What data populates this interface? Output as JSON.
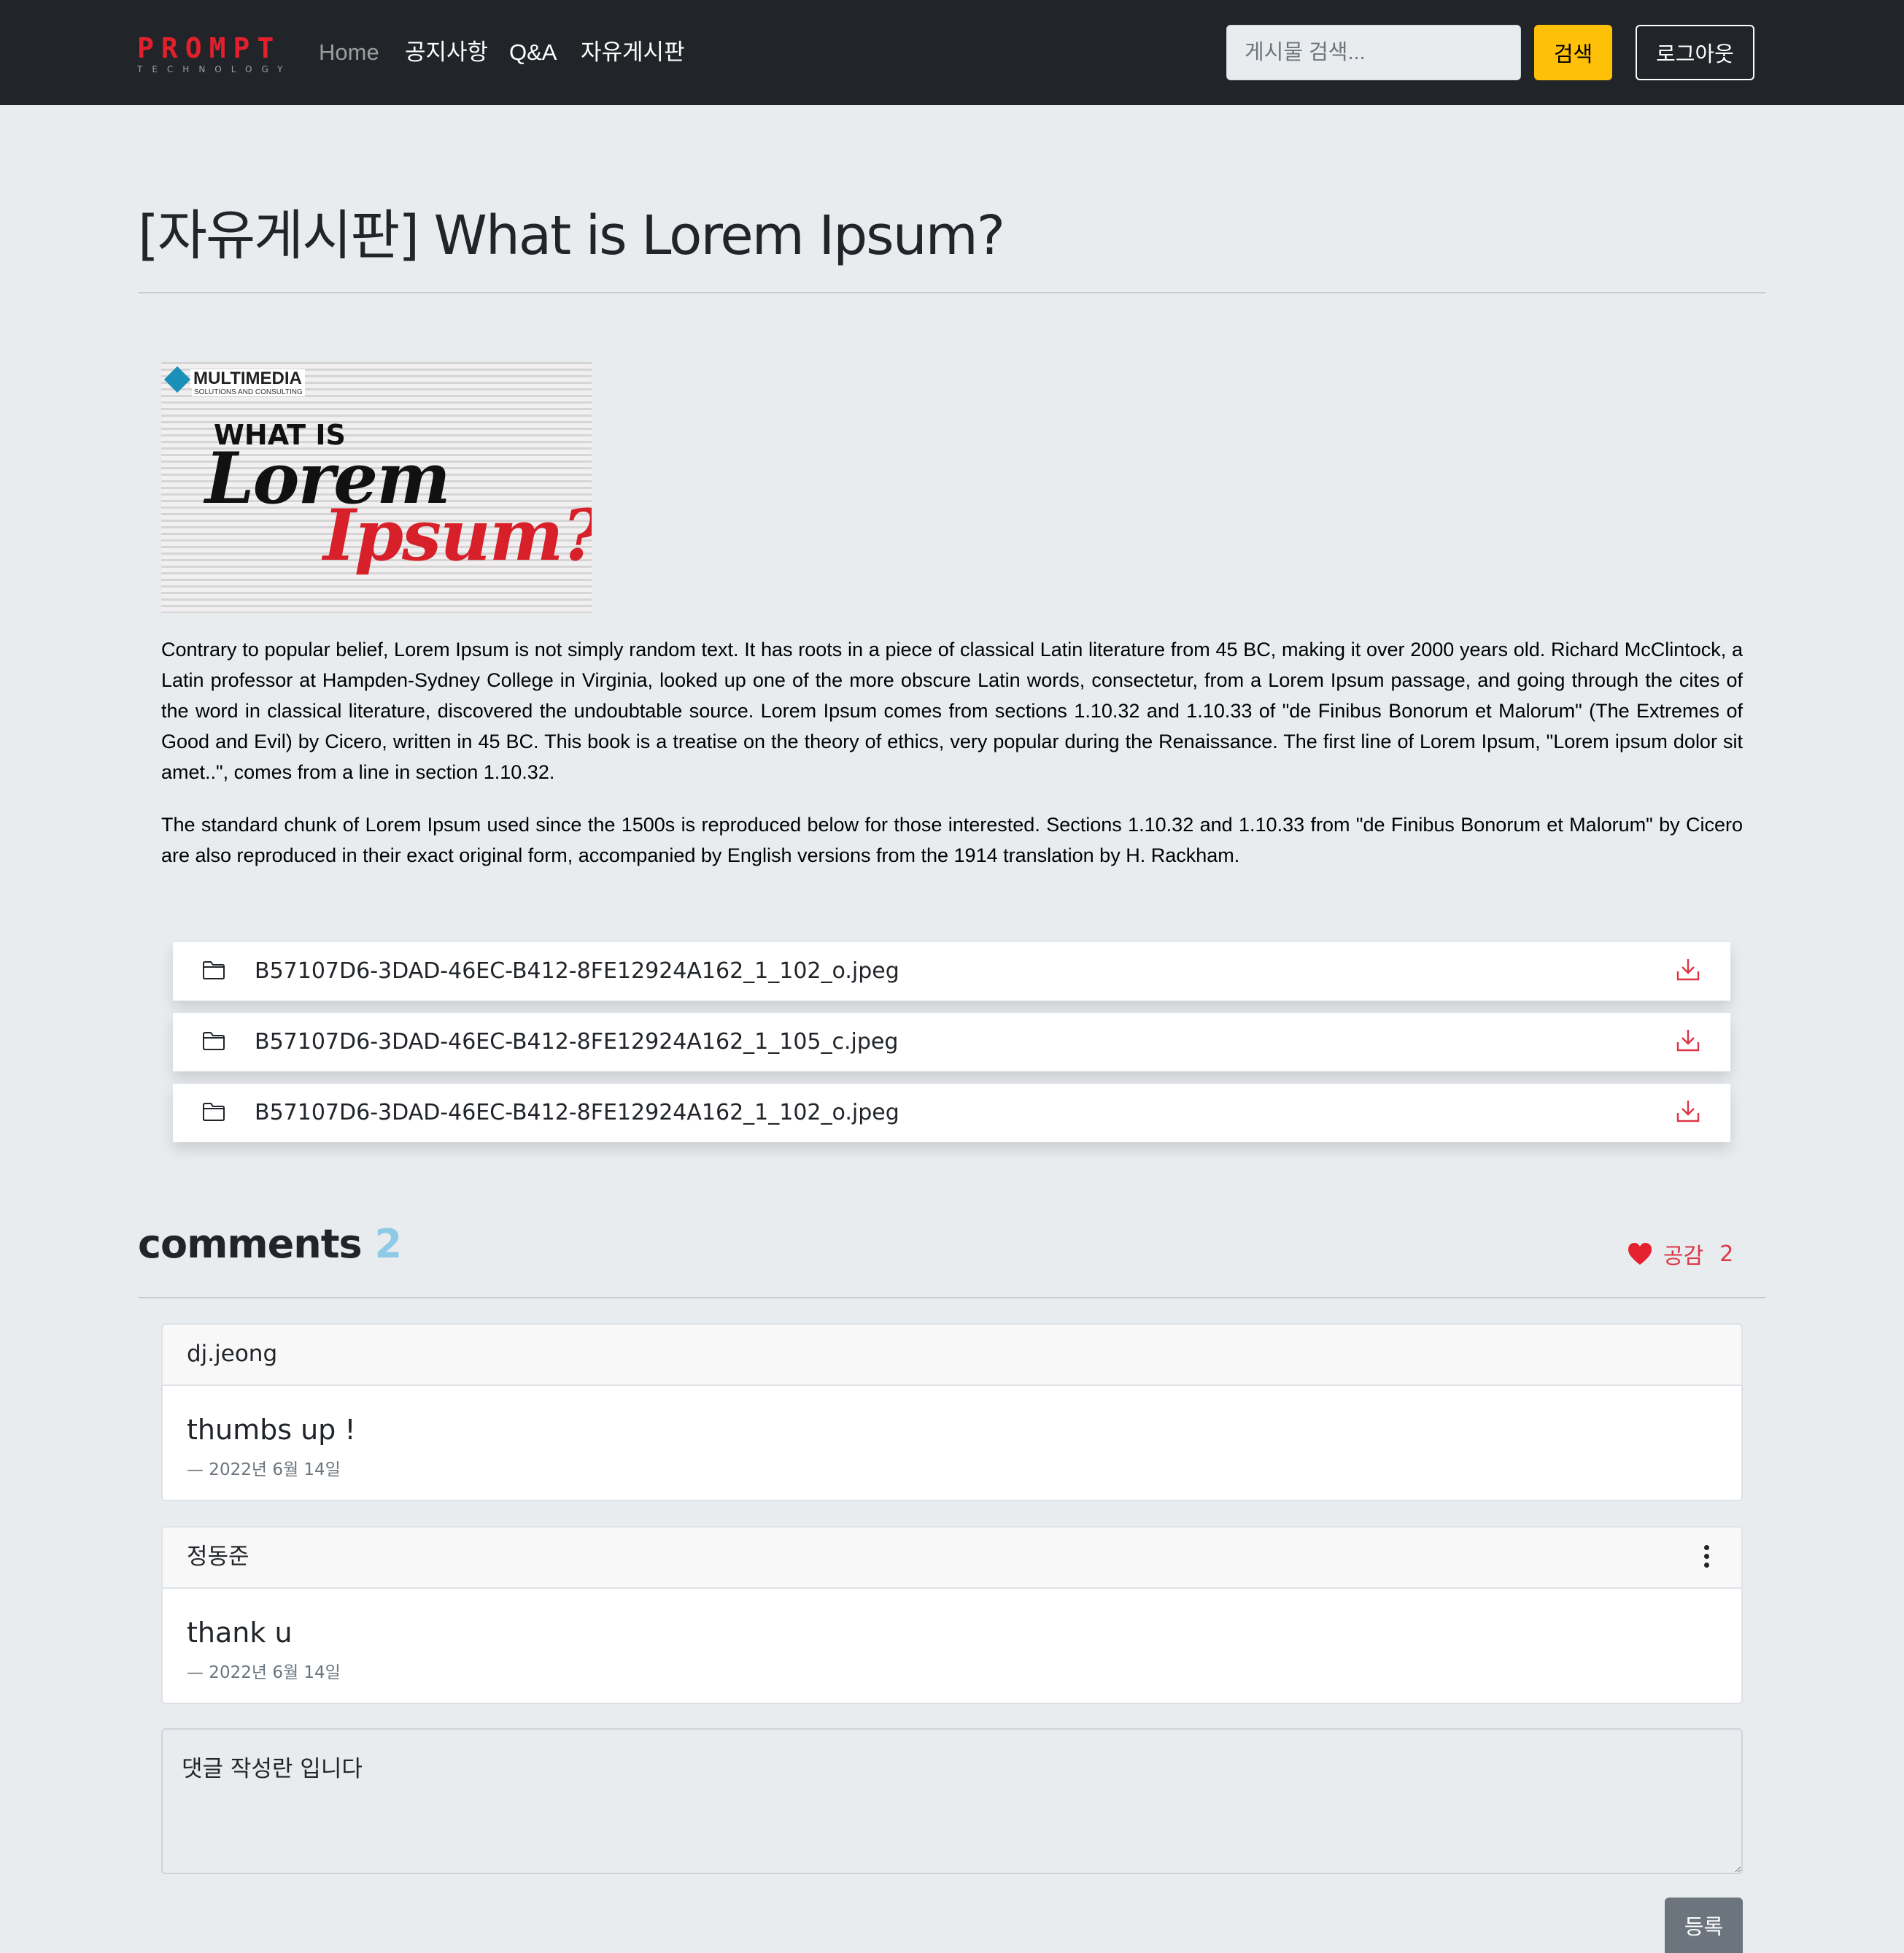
{
  "navbar": {
    "brand_main": "PROMPT",
    "brand_sub": "TECHNOLOGY",
    "links": [
      {
        "label": "Home"
      },
      {
        "label": "공지사항"
      },
      {
        "label": "Q&A"
      },
      {
        "label": "자유게시판"
      }
    ],
    "search_placeholder": "게시물 검색...",
    "search_button": "검색",
    "logout_button": "로그아웃"
  },
  "post": {
    "title": "[자유게시판] What is Lorem Ipsum?",
    "image": {
      "brand": "MULTIMEDIA",
      "brand_sub": "SOLUTIONS AND CONSULTING",
      "line1": "WHAT IS",
      "line2": "Lorem",
      "line3": "Ipsum?"
    },
    "paragraphs": [
      "Contrary to popular belief, Lorem Ipsum is not simply random text. It has roots in a piece of classical Latin literature from 45 BC, making it over 2000 years old. Richard McClintock, a Latin professor at Hampden-Sydney College in Virginia, looked up one of the more obscure Latin words, consectetur, from a Lorem Ipsum passage, and going through the cites of the word in classical literature, discovered the undoubtable source. Lorem Ipsum comes from sections 1.10.32 and 1.10.33 of \"de Finibus Bonorum et Malorum\" (The Extremes of Good and Evil) by Cicero, written in 45 BC. This book is a treatise on the theory of ethics, very popular during the Renaissance. The first line of Lorem Ipsum, \"Lorem ipsum dolor sit amet..\", comes from a line in section 1.10.32.",
      "The standard chunk of Lorem Ipsum used since the 1500s is reproduced below for those interested. Sections 1.10.32 and 1.10.33 from \"de Finibus Bonorum et Malorum\" by Cicero are also reproduced in their exact original form, accompanied by English versions from the 1914 translation by H. Rackham."
    ],
    "attachments": [
      {
        "name": "B57107D6-3DAD-46EC-B412-8FE12924A162_1_102_o.jpeg",
        "icon": "folder-icon",
        "action_icon": "download-icon"
      },
      {
        "name": "B57107D6-3DAD-46EC-B412-8FE12924A162_1_105_c.jpeg",
        "icon": "folder-icon",
        "action_icon": "download-icon"
      },
      {
        "name": "B57107D6-3DAD-46EC-B412-8FE12924A162_1_102_o.jpeg",
        "icon": "folder-icon",
        "action_icon": "download-icon"
      }
    ]
  },
  "comments": {
    "heading": "comments",
    "count": "2",
    "like_label": "공감",
    "like_count": "2",
    "items": [
      {
        "author": "dj.jeong",
        "text": "thumbs up !",
        "date": "— 2022년 6월 14일",
        "has_menu": false
      },
      {
        "author": "정동준",
        "text": "thank u",
        "date": "— 2022년 6월 14일",
        "has_menu": true
      }
    ],
    "textarea_placeholder": "댓글 작성란 입니다",
    "submit_button": "등록"
  },
  "colors": {
    "navbar_bg": "#212529",
    "page_bg": "#e9ecef",
    "brand_red": "#e0202c",
    "search_button": "#ffc107",
    "like_red": "#dc3545",
    "count_blue": "#8ecae6",
    "submit_gray": "#6c757d"
  }
}
